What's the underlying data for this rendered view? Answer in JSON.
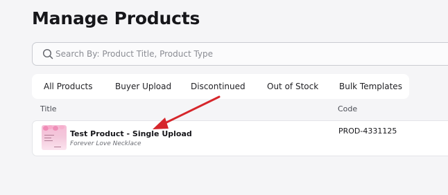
{
  "page": {
    "title": "Manage Products"
  },
  "search": {
    "placeholder": "Search By: Product Title, Product Type",
    "value": ""
  },
  "tabs": [
    {
      "label": "All Products"
    },
    {
      "label": "Buyer Upload"
    },
    {
      "label": "Discontinued"
    },
    {
      "label": "Out of Stock"
    },
    {
      "label": "Bulk Templates"
    }
  ],
  "table": {
    "columns": [
      "Title",
      "Code"
    ],
    "rows": [
      {
        "title": "Test Product - Single Upload",
        "subtitle": "Forever Love Necklace",
        "code": "PROD-4331125"
      }
    ]
  },
  "colors": {
    "annotation_arrow": "#d6262b",
    "thumbnail": "#f3c7db"
  },
  "icons": {
    "search": "search-icon"
  }
}
